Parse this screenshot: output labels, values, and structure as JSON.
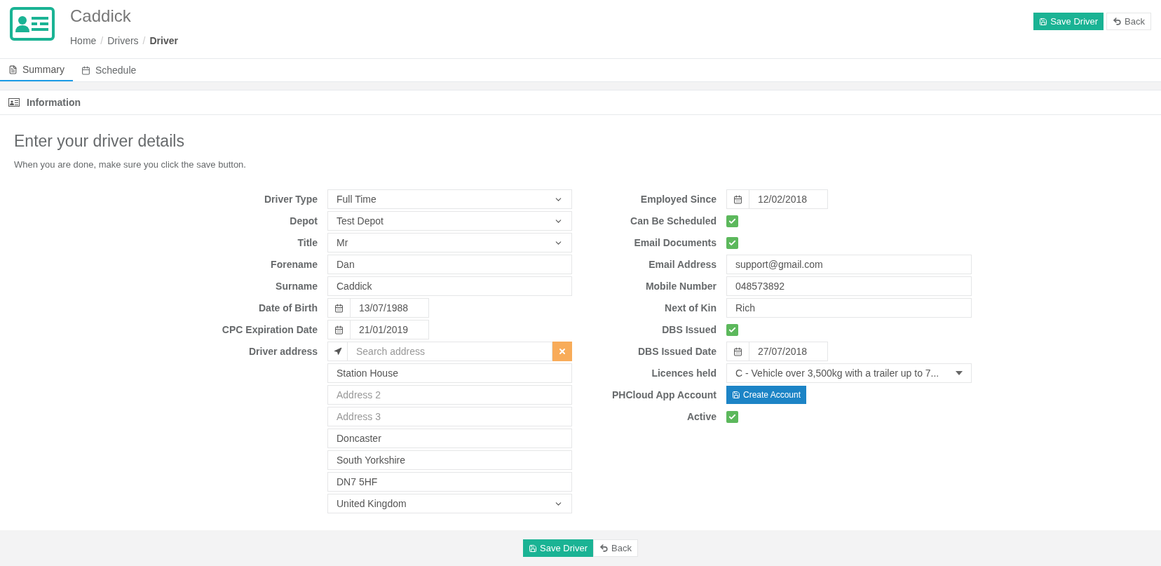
{
  "header": {
    "title": "Caddick",
    "breadcrumb": [
      {
        "label": "Home",
        "current": false
      },
      {
        "label": "Drivers",
        "current": false
      },
      {
        "label": "Driver",
        "current": true
      }
    ],
    "separator": "/",
    "save": "Save Driver",
    "back": "Back"
  },
  "tabs": [
    {
      "label": "Summary",
      "selected": true
    },
    {
      "label": "Schedule",
      "selected": false
    }
  ],
  "section": {
    "title": "Information"
  },
  "intro": {
    "heading": "Enter your driver details",
    "text": "When you are done, make sure you click the save button."
  },
  "left_fields": [
    {
      "kind": "select",
      "label": "Driver Type",
      "value": "Full Time"
    },
    {
      "kind": "select",
      "label": "Depot",
      "value": "Test Depot"
    },
    {
      "kind": "select",
      "label": "Title",
      "value": "Mr"
    },
    {
      "kind": "text",
      "label": "Forename",
      "value": "Dan"
    },
    {
      "kind": "text",
      "label": "Surname",
      "value": "Caddick"
    },
    {
      "kind": "date",
      "label": "Date of Birth",
      "value": "13/07/1988"
    },
    {
      "kind": "date",
      "label": "CPC Expiration Date",
      "value": "21/01/2019"
    },
    {
      "kind": "address",
      "label": "Driver address",
      "placeholder": "Search address",
      "lines": [
        {
          "kind": "text",
          "value": "Station House"
        },
        {
          "kind": "text",
          "placeholder": "Address 2"
        },
        {
          "kind": "text",
          "placeholder": "Address 3"
        },
        {
          "kind": "text",
          "value": "Doncaster"
        },
        {
          "kind": "text",
          "value": "South Yorkshire"
        },
        {
          "kind": "text",
          "value": "DN7 5HF"
        },
        {
          "kind": "select",
          "value": "United Kingdom"
        }
      ]
    }
  ],
  "right_fields": [
    {
      "kind": "date",
      "label": "Employed Since",
      "value": "12/02/2018"
    },
    {
      "kind": "checkbox",
      "label": "Can Be Scheduled",
      "checked": true
    },
    {
      "kind": "checkbox",
      "label": "Email Documents",
      "checked": true
    },
    {
      "kind": "text",
      "label": "Email Address",
      "value": "support@gmail.com"
    },
    {
      "kind": "text",
      "label": "Mobile Number",
      "value": "048573892"
    },
    {
      "kind": "text",
      "label": "Next of Kin",
      "value": "Rich"
    },
    {
      "kind": "checkbox",
      "label": "DBS Issued",
      "checked": true
    },
    {
      "kind": "date",
      "label": "DBS Issued Date",
      "value": "27/07/2018"
    },
    {
      "kind": "multiselect",
      "label": "Licences held",
      "value": "C - Vehicle over 3,500kg with a trailer up to 7..."
    },
    {
      "kind": "button",
      "label": "PHCloud App Account",
      "value": "Create Account"
    },
    {
      "kind": "checkbox",
      "label": "Active",
      "checked": true
    }
  ],
  "footer": {
    "save": "Save Driver",
    "back": "Back"
  }
}
